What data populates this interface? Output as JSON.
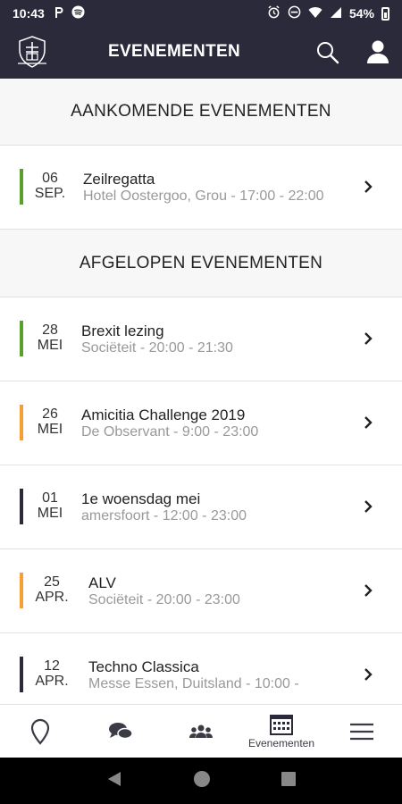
{
  "status_bar": {
    "time": "10:43",
    "battery": "54%",
    "icons": [
      "parking-icon",
      "spotify-icon",
      "alarm-icon",
      "dnd-icon",
      "wifi-icon",
      "signal-icon",
      "battery-icon"
    ]
  },
  "app_bar": {
    "title": "EVENEMENTEN",
    "logo": "society-crest-logo",
    "actions": [
      "search-icon",
      "user-icon"
    ]
  },
  "upcoming": {
    "header": "AANKOMENDE EVENEMENTEN",
    "events": [
      {
        "day": "06",
        "month": "SEP.",
        "title": "Zeilregatta",
        "subtitle": "Hotel Oostergoo, Grou - 17:00 - 22:00",
        "color": "#5aa02c"
      }
    ]
  },
  "past": {
    "header": "AFGELOPEN EVENEMENTEN",
    "events": [
      {
        "day": "28",
        "month": "MEI",
        "title": "Brexit lezing",
        "subtitle": "Sociëteit - 20:00 - 21:30",
        "color": "#5aa02c"
      },
      {
        "day": "26",
        "month": "MEI",
        "title": "Amicitia Challenge 2019",
        "subtitle": "De Observant - 9:00 - 23:00",
        "color": "#f5a033"
      },
      {
        "day": "01",
        "month": "MEI",
        "title": "1e woensdag mei",
        "subtitle": "amersfoort - 12:00 - 23:00",
        "color": "#2b2a3a"
      },
      {
        "day": "25",
        "month": "APR.",
        "title": "ALV",
        "subtitle": "Sociëteit - 20:00 - 23:00",
        "color": "#f5a033"
      },
      {
        "day": "12",
        "month": "APR.",
        "title": "Techno Classica",
        "subtitle": "Messe Essen, Duitsland - 10:00 -",
        "color": "#2b2a3a"
      }
    ]
  },
  "bottom_nav": {
    "items": [
      {
        "icon": "map-pin-icon",
        "label": ""
      },
      {
        "icon": "chat-icon",
        "label": ""
      },
      {
        "icon": "members-icon",
        "label": ""
      },
      {
        "icon": "calendar-icon",
        "label": "Evenementen"
      },
      {
        "icon": "menu-icon",
        "label": ""
      }
    ]
  },
  "colors": {
    "header_bg": "#2b2a3a",
    "green": "#5aa02c",
    "orange": "#f5a033",
    "navy": "#2b2a3a"
  }
}
